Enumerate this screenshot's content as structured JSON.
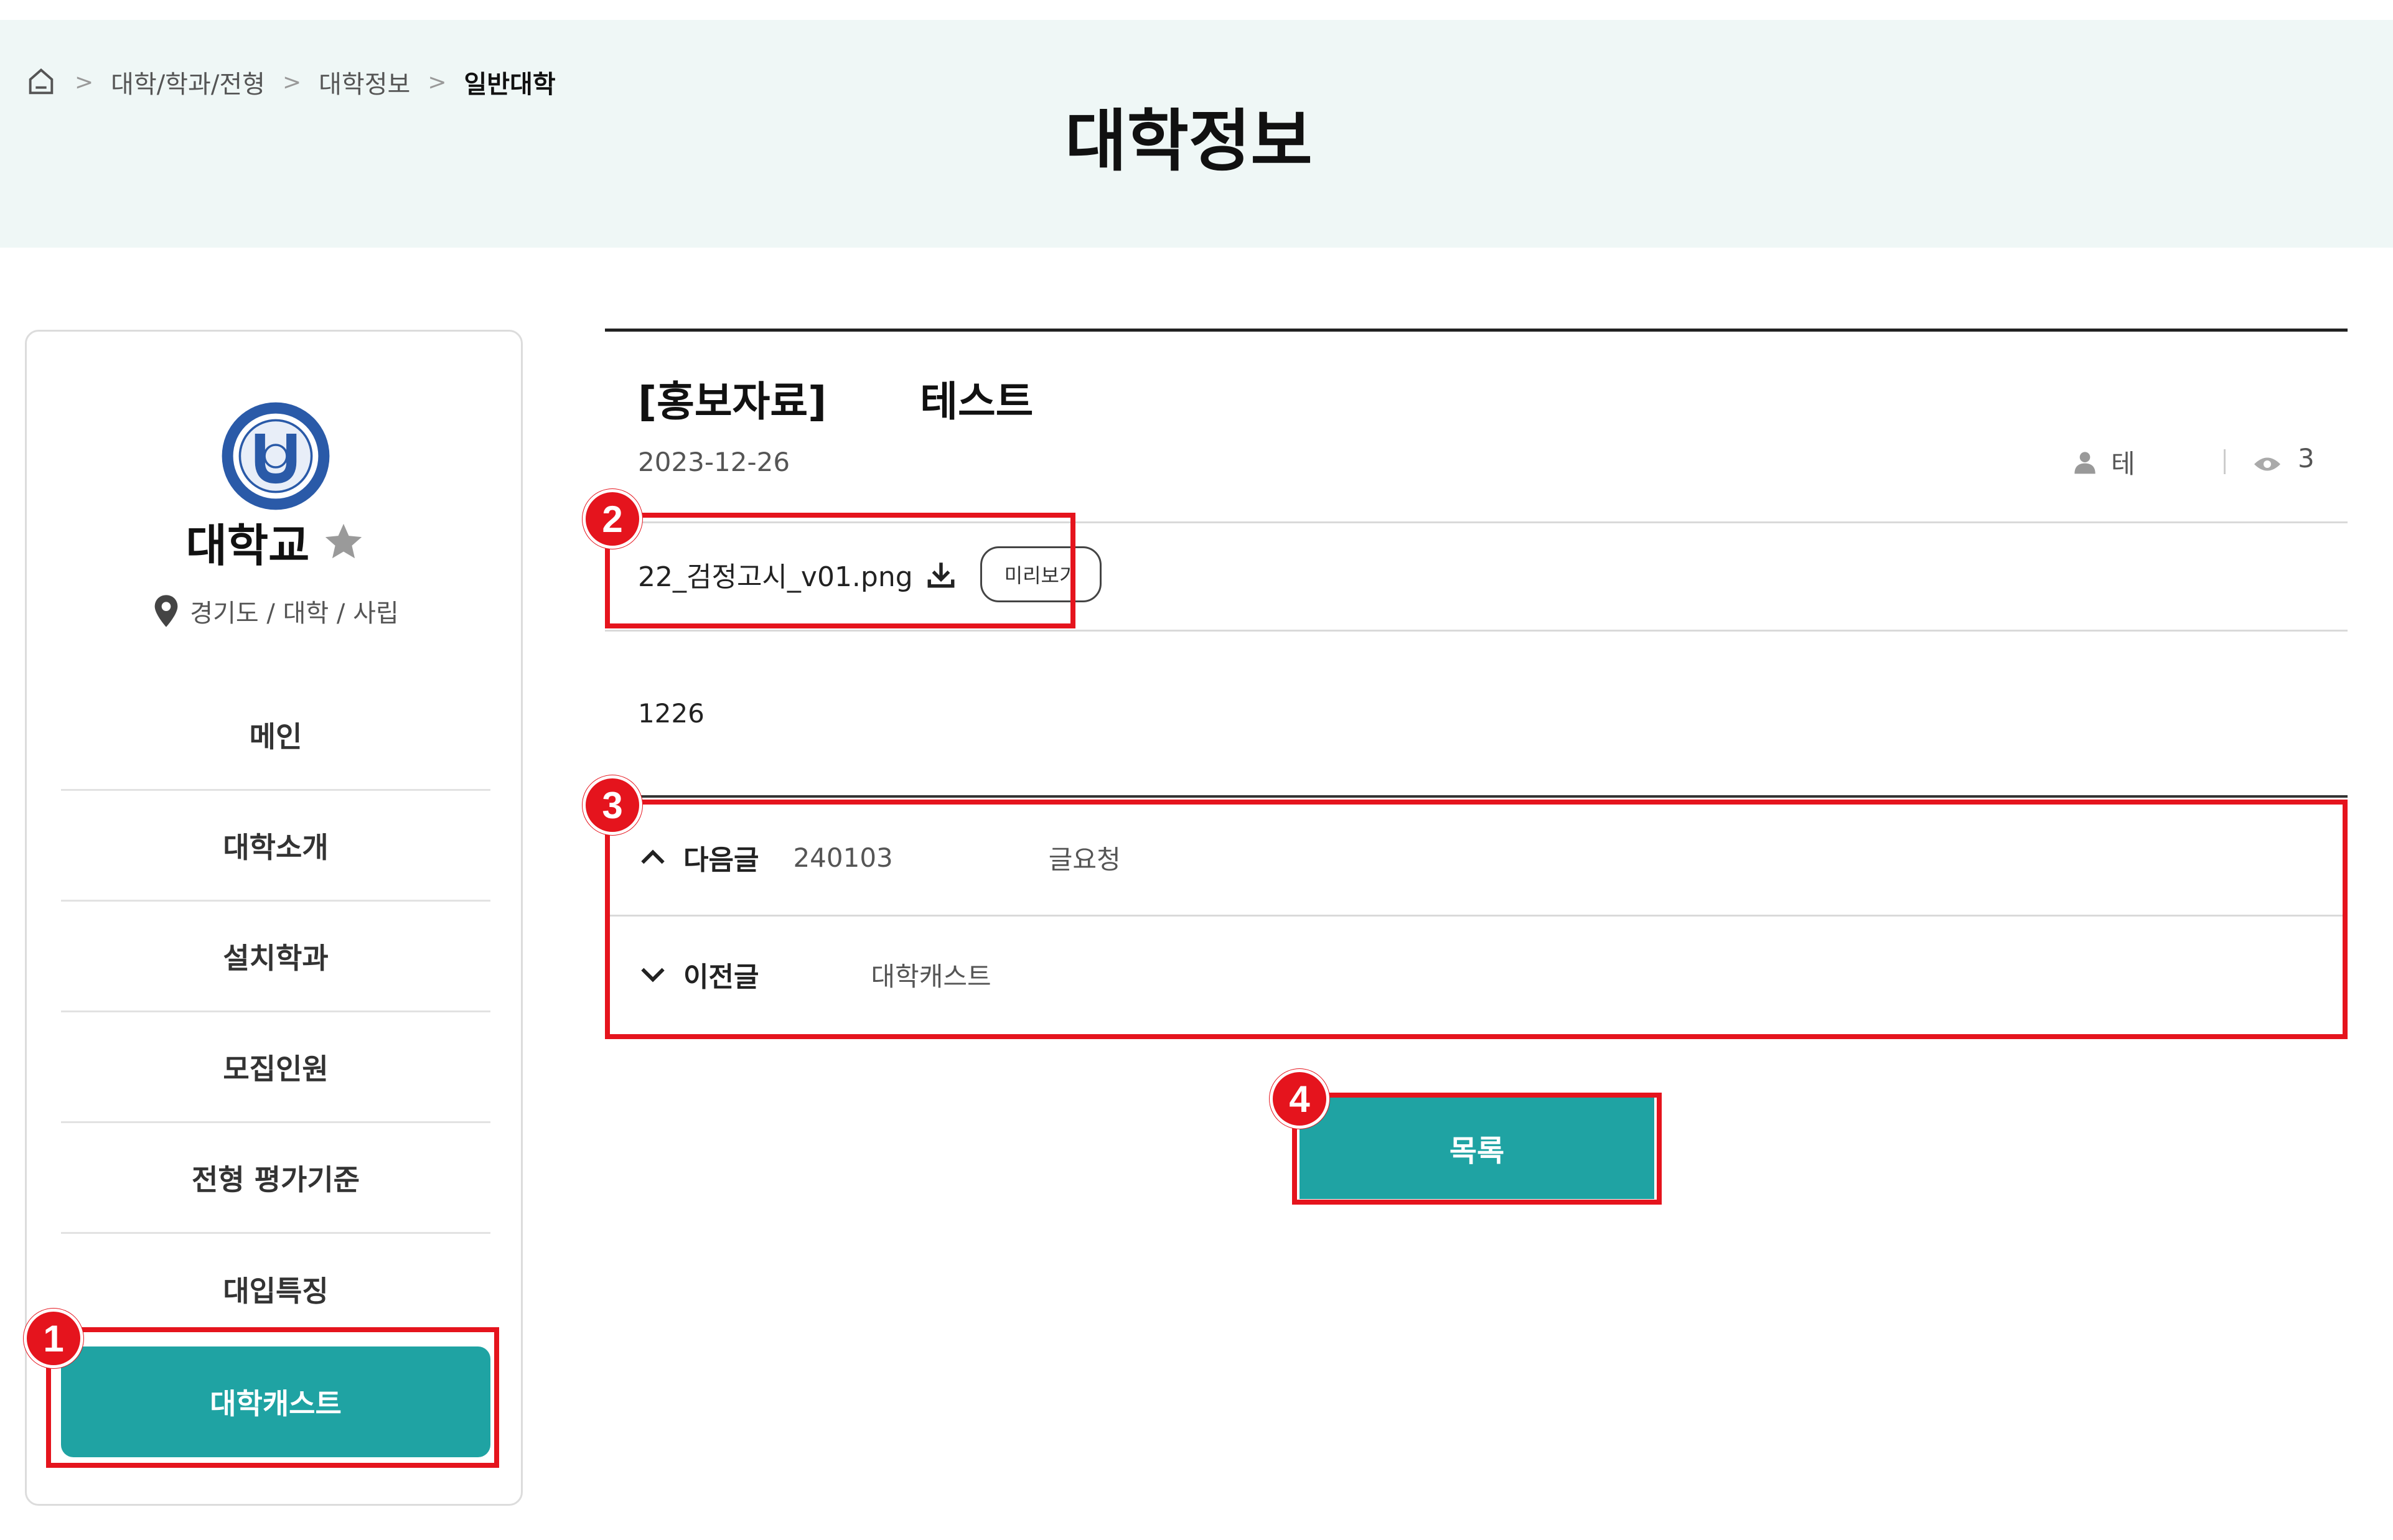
{
  "breadcrumb": {
    "home_icon": "home-icon",
    "items": [
      "대학/학과/전형",
      "대학정보"
    ],
    "current": "일반대학"
  },
  "page_title": "대학정보",
  "sidebar": {
    "logo_icon": "university-seal-logo",
    "university_name": "대학교",
    "favorite_icon": "star-icon",
    "location": "경기도 / 대학 / 사립",
    "menu": [
      "메인",
      "대학소개",
      "설치학과",
      "모집인원",
      "전형 평가기준",
      "대입특징"
    ],
    "active_item": "대학캐스트"
  },
  "post": {
    "category": "[홍보자료]",
    "title": "테스트",
    "date": "2023-12-26",
    "author": "테",
    "views": "3",
    "attachment": {
      "filename": "22_검정고시_v01.png",
      "preview_label": "미리보기"
    },
    "body": "1226"
  },
  "navigation": {
    "next_label": "다음글",
    "next_subject_prefix": "240103",
    "next_subject_suffix": "글요청",
    "prev_label": "이전글",
    "prev_subject": "대학캐스트"
  },
  "list_button": "목록",
  "annotations": {
    "colors": {
      "highlight": "#e5141d",
      "accent": "#1fa3a3"
    },
    "badges": [
      "1",
      "2",
      "3",
      "4"
    ]
  }
}
